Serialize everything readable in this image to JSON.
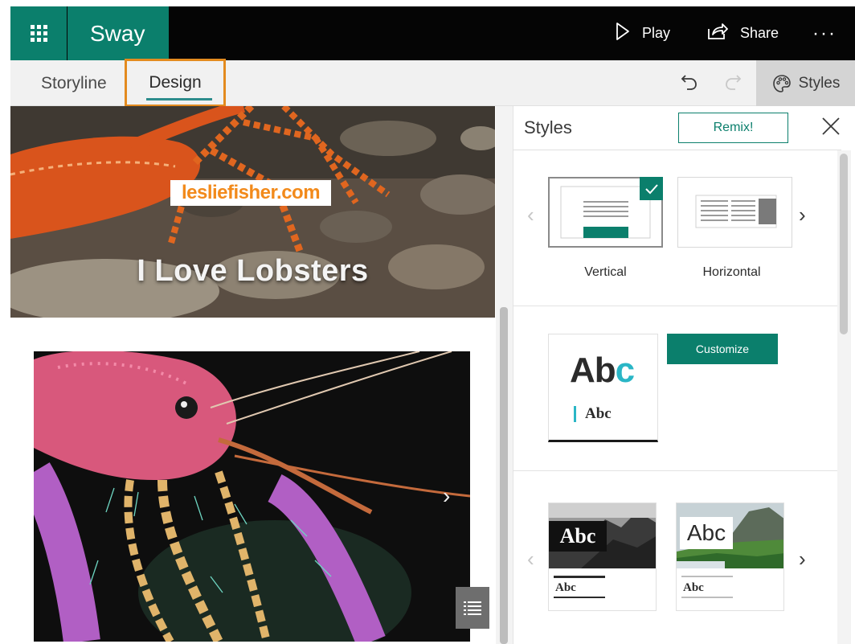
{
  "app": {
    "name": "Sway"
  },
  "topbar": {
    "play_label": "Play",
    "share_label": "Share",
    "more_label": "···"
  },
  "tabs": [
    {
      "label": "Storyline"
    },
    {
      "label": "Design"
    }
  ],
  "toolbar": {
    "styles_label": "Styles"
  },
  "canvas": {
    "brand_tag": "lesliefisher.com",
    "hero_title": "I Love Lobsters"
  },
  "styles_pane": {
    "title": "Styles",
    "remix_label": "Remix!",
    "layouts": [
      {
        "label": "Vertical",
        "selected": true
      },
      {
        "label": "Horizontal",
        "selected": false
      }
    ],
    "theme_preview": {
      "heading": "Ab",
      "heading_accent": "c",
      "body": "Abc"
    },
    "customize_label": "Customize",
    "style_cards": [
      {
        "heading": "Abc",
        "body": "Abc"
      },
      {
        "heading": "Abc",
        "body": "Abc"
      }
    ]
  },
  "colors": {
    "brand_green": "#0b7f6c",
    "highlight_orange": "#e38b1f",
    "accent_teal": "#2ab6c6"
  }
}
